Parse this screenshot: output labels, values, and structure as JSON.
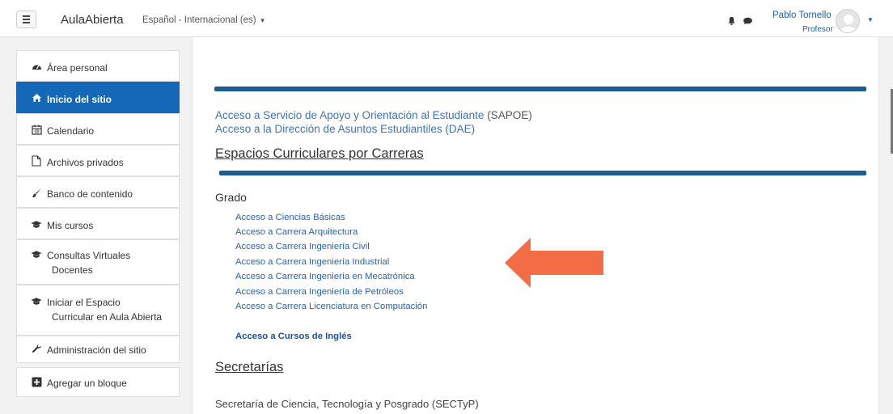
{
  "navbar": {
    "brand": "AulaAbierta",
    "language": "Español - Internacional (es)",
    "user_name": "Pablo Tornello",
    "user_role": "Profesor"
  },
  "sidebar": {
    "items": [
      {
        "label": "Área personal",
        "icon": "dashboard-icon"
      },
      {
        "label": "Inicio del sitio",
        "icon": "home-icon",
        "active": true
      },
      {
        "label": "Calendario",
        "icon": "calendar-icon"
      },
      {
        "label": "Archivos privados",
        "icon": "file-icon"
      },
      {
        "label": "Banco de contenido",
        "icon": "brush-icon"
      },
      {
        "label": "Mis cursos",
        "icon": "graduation-cap-icon"
      },
      {
        "label_line1": "Consultas Virtuales",
        "label_line2": "Docentes",
        "icon": "graduation-cap-icon"
      },
      {
        "label_line1": "Iniciar el Espacio",
        "label_line2": "Curricular en Aula Abierta",
        "icon": "graduation-cap-icon"
      },
      {
        "label": "Administración del sitio",
        "icon": "wrench-icon"
      },
      {
        "label": "Agregar un bloque",
        "icon": "plus-square-icon"
      }
    ]
  },
  "main": {
    "sapoe_link": "Acceso a Servicio de Apoyo y Orientación al Estudiante",
    "sapoe_suffix": " (SAPOE)",
    "dae_link": "Acceso a la Dirección de Asuntos Estudiantiles (DAE)",
    "espacios_heading": "Espacios Curriculares por Carreras",
    "grado_label": "Grado",
    "carreras": [
      "Acceso a Ciencias Básicas",
      "Acceso a Carrera Arquitectura",
      "Acceso a Carrera Ingeniería Civil",
      "Acceso a Carrera Ingeniería Industrial",
      "Acceso a Carrera Ingeniería en Mecatrónica",
      "Acceso a Carrera Ingeniería de Petróleos",
      "Acceso a Carrera Licenciatura en Computación"
    ],
    "ingles_link": "Acceso a Cursos de Inglés",
    "secretarias_heading": "Secretarías",
    "secretaria_item": "Secretaría de Ciencia, Tecnología y Posgrado (SECTyP)"
  },
  "colors": {
    "accent": "#1468b7",
    "bar": "#1d5c91",
    "arrow": "#f26c45"
  }
}
